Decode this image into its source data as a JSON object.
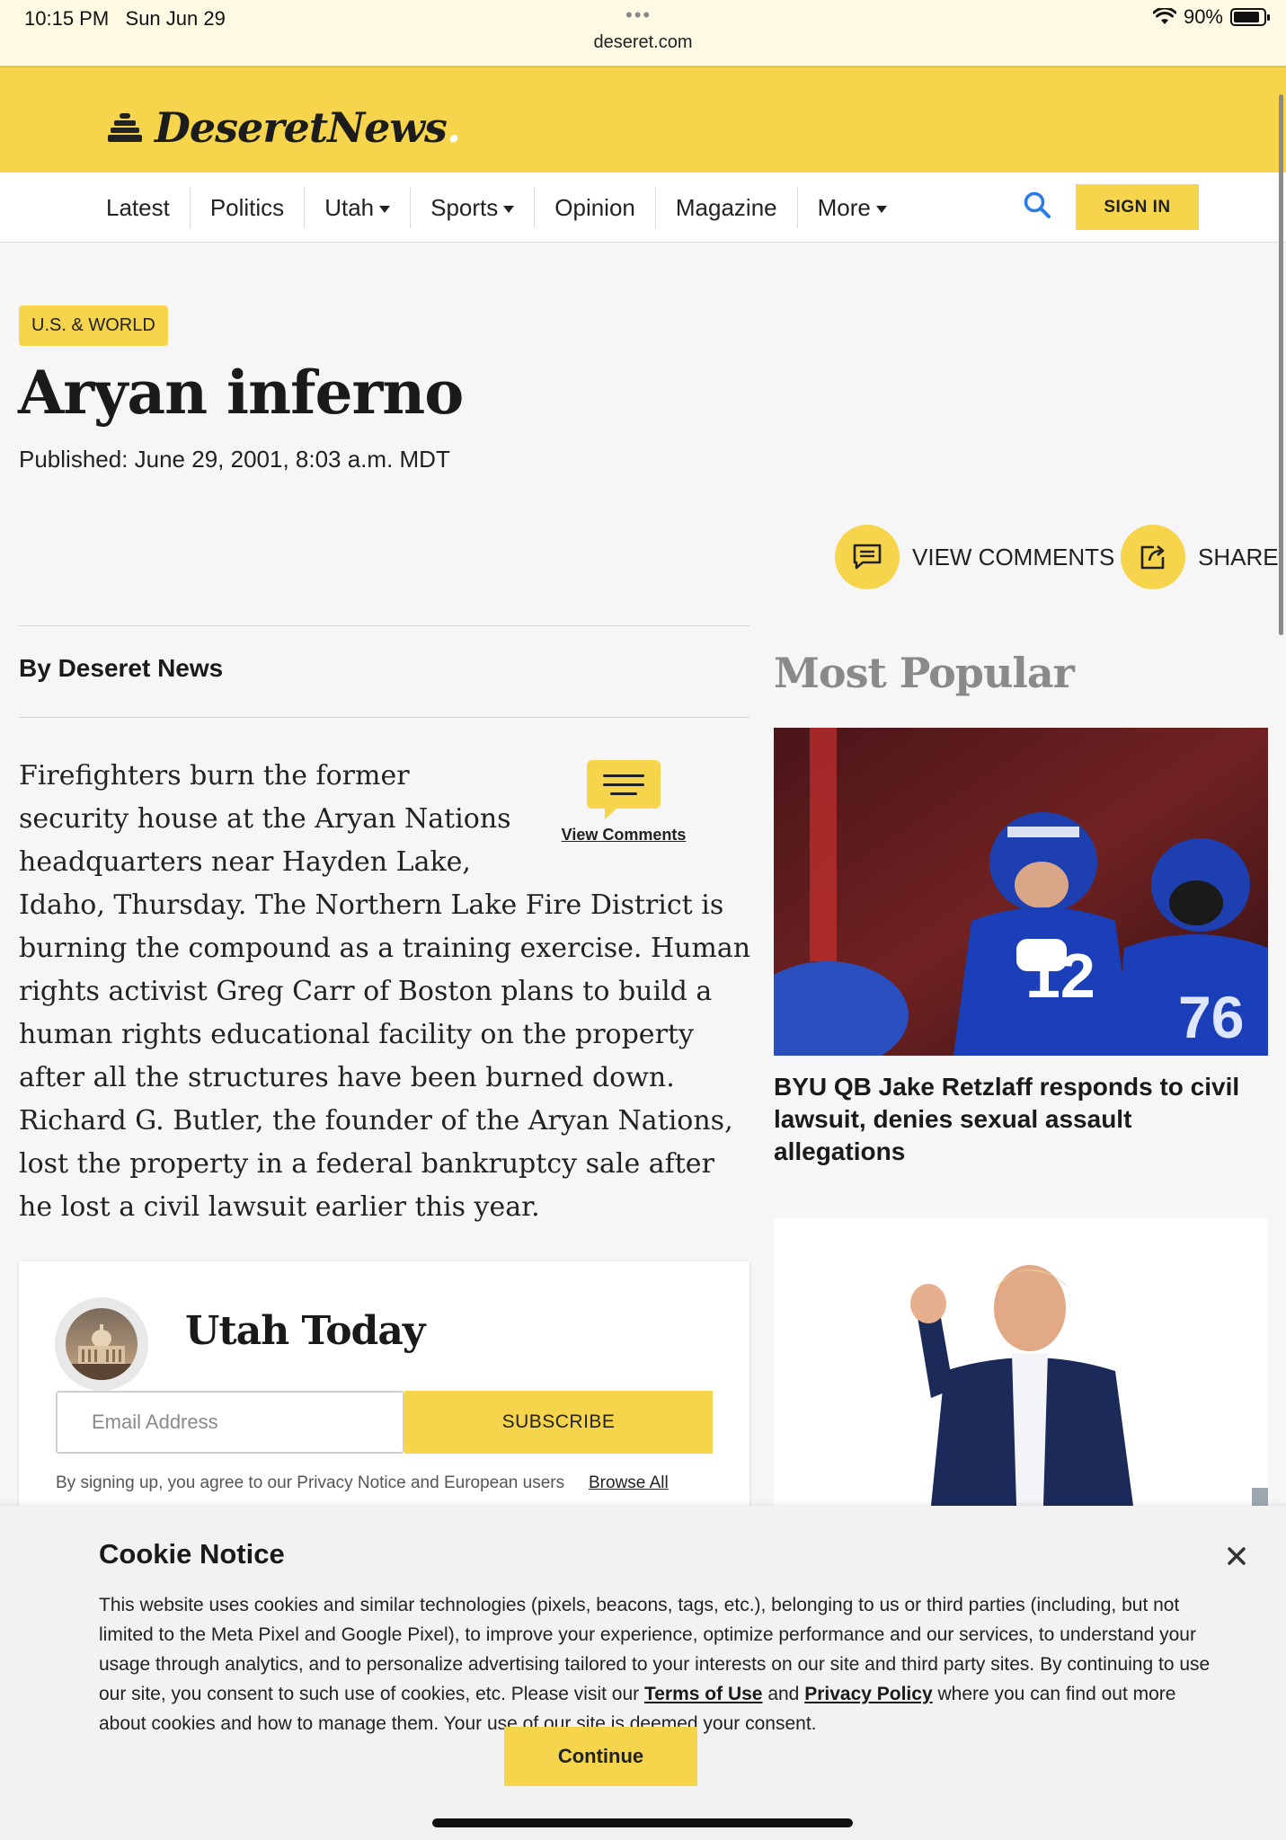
{
  "status_bar": {
    "time": "10:15 PM",
    "date": "Sun Jun 29",
    "url": "deseret.com",
    "battery": "90%",
    "icons": [
      "wifi-icon",
      "battery-icon"
    ]
  },
  "header": {
    "logo_text": "DeseretNews",
    "logo_dot": ".",
    "logo_icon": "beehive-icon"
  },
  "nav": {
    "items": [
      {
        "label": "Latest",
        "dropdown": false
      },
      {
        "label": "Politics",
        "dropdown": false
      },
      {
        "label": "Utah",
        "dropdown": true
      },
      {
        "label": "Sports",
        "dropdown": true
      },
      {
        "label": "Opinion",
        "dropdown": false
      },
      {
        "label": "Magazine",
        "dropdown": false
      },
      {
        "label": "More",
        "dropdown": true
      }
    ],
    "search_icon": "search-icon",
    "sign_in": "SIGN IN"
  },
  "article": {
    "category": "U.S. & WORLD",
    "title": "Aryan inferno",
    "published": "Published: June 29, 2001, 8:03 a.m. MDT",
    "actions": {
      "comments": "VIEW COMMENTS",
      "share": "SHARE"
    },
    "byline": "By Deseret News",
    "view_comments_link": "View Comments",
    "body": "Firefighters burn the former security house at the Aryan Nations headquarters near Hayden Lake, Idaho, Thursday. The Northern Lake Fire District is burning the compound as a training exercise. Human rights activist Greg Carr of Boston plans to build a human rights educational facility on the property after all the structures have been burned down. Richard G. Butler, the founder of the Aryan Nations, lost the property in a federal bankruptcy sale after he lost a civil lawsuit earlier this year."
  },
  "newsletter": {
    "title": "Utah Today",
    "email_placeholder": "Email Address",
    "subscribe": "SUBSCRIBE",
    "fine_print": "By signing up, you agree to our Privacy Notice and European users",
    "browse_all": "Browse All"
  },
  "sidebar": {
    "title": "Most Popular",
    "stories": [
      {
        "headline": "BYU QB Jake Retzlaff responds to civil lawsuit, denies sexual assault allegations"
      }
    ]
  },
  "cookie_notice": {
    "title": "Cookie Notice",
    "text_before_terms": "This website uses cookies and similar technologies (pixels, beacons, tags, etc.), belonging to us or third parties (including, but not limited to the Meta Pixel and Google Pixel), to improve your experience, optimize performance and our services, to understand your usage through analytics, and to personalize advertising tailored to your interests on our site and third party sites. By continuing to use our site, you consent to such use of cookies, etc. Please visit our ",
    "terms_link": "Terms of Use",
    "and_text": " and ",
    "privacy_link": "Privacy Policy",
    "text_after_privacy": " where you can find out more about cookies and how to manage them. Your use of our site is deemed your consent.",
    "continue": "Continue"
  },
  "colors": {
    "brand_yellow": "#f6d44b",
    "text_dark": "#1a1a1a",
    "muted_gray": "#8a8a8a"
  }
}
